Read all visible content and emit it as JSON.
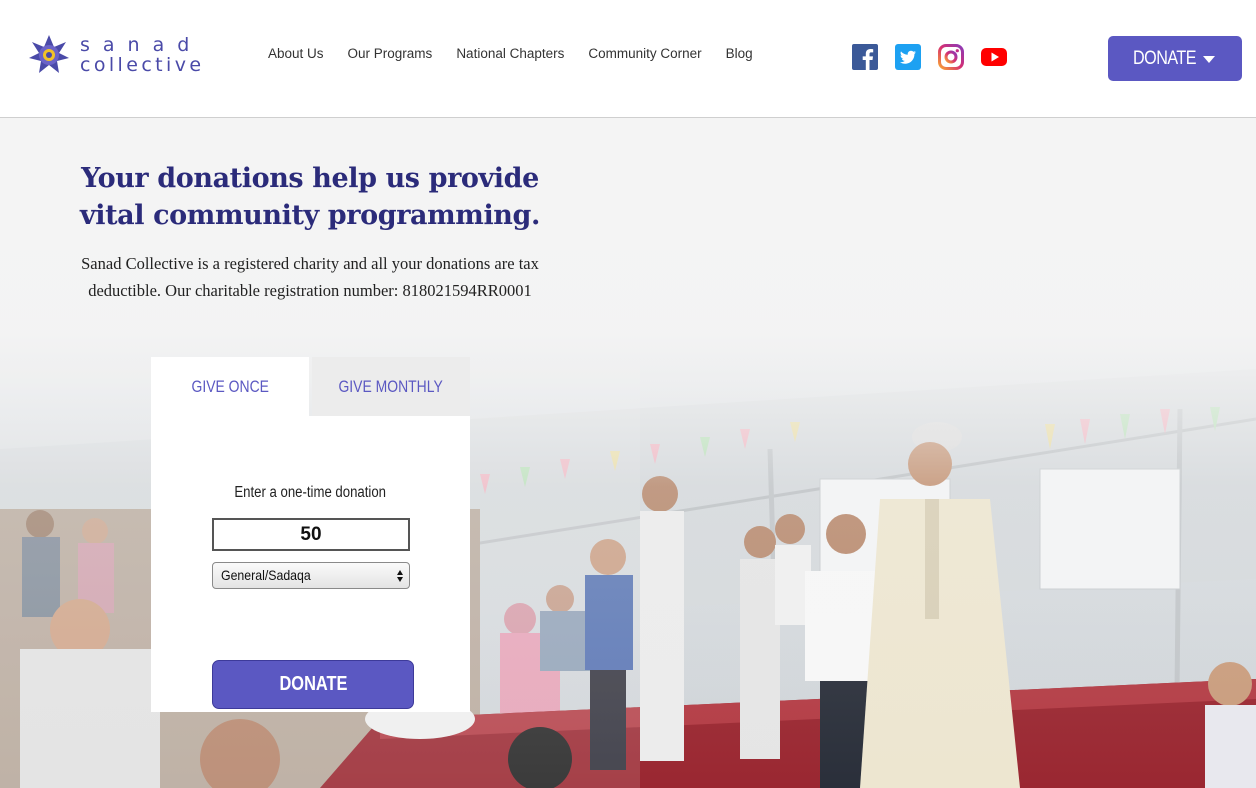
{
  "header": {
    "logo_line1": "sanad",
    "logo_line2": "collective",
    "nav": [
      "About Us",
      "Our Programs",
      "National Chapters",
      "Community Corner",
      "Blog"
    ],
    "donate_label": "DONATE",
    "socials": [
      "facebook-icon",
      "twitter-icon",
      "instagram-icon",
      "youtube-icon"
    ]
  },
  "intro": {
    "title": "Your donations help us provide vital community programming.",
    "body": "Sanad Collective is a registered charity and all your donations are tax deductible. Our charitable registration number: 818021594RR0001"
  },
  "widget": {
    "tab_once": "GIVE ONCE",
    "tab_monthly": "GIVE MONTHLY",
    "prompt": "Enter a one-time donation",
    "amount": "50",
    "fund_selected": "General/Sadaqa",
    "donate_label": "DONATE"
  },
  "colors": {
    "brand": "#5b58c2",
    "title": "#2b2b7a",
    "facebook": "#3b5998",
    "twitter": "#1da1f2",
    "youtube": "#ff0000"
  }
}
